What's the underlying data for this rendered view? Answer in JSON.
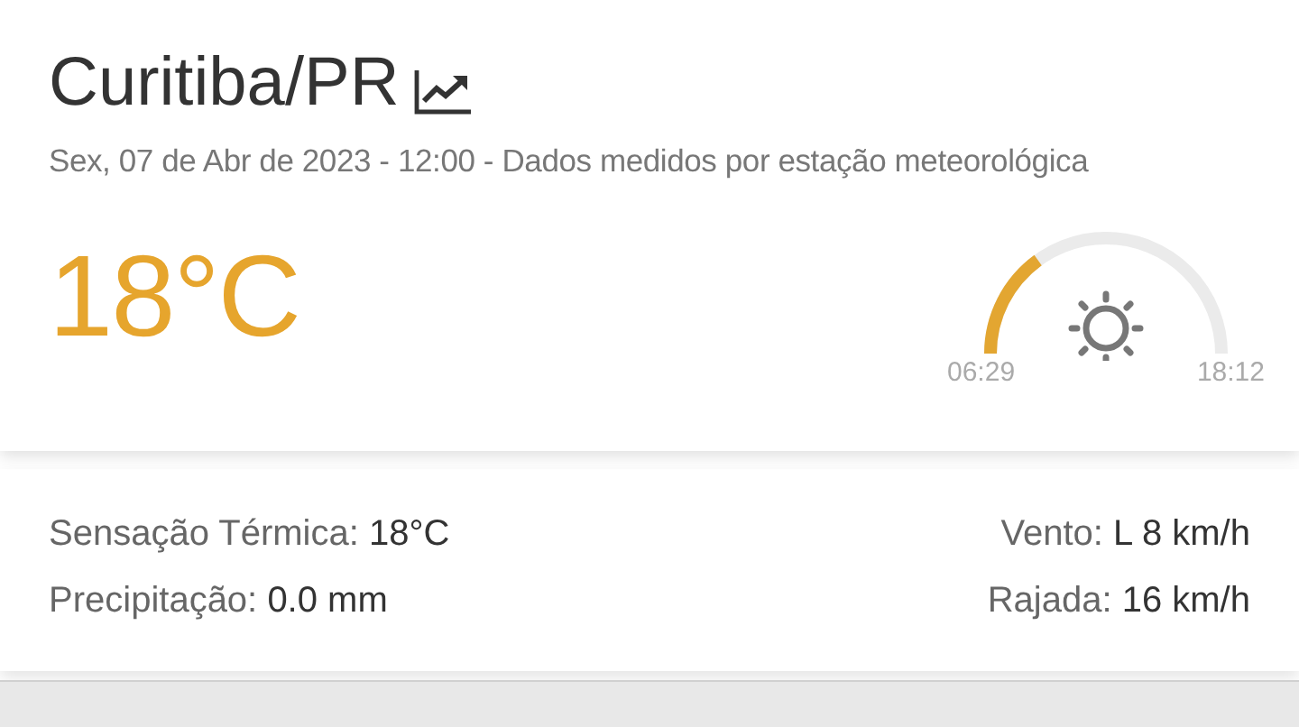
{
  "location": {
    "title": "Curitiba/PR"
  },
  "subtitle": "Sex, 07 de Abr de 2023 - 12:00 - Dados medidos por estação meteorológica",
  "temperature": "18°C",
  "sun": {
    "sunrise": "06:29",
    "sunset": "18:12"
  },
  "details": [
    {
      "label": "Sensação Térmica:",
      "value": "18°C"
    },
    {
      "label": "Vento:",
      "value": "L 8 km/h"
    },
    {
      "label": "Precipitação:",
      "value": "0.0 mm"
    },
    {
      "label": "Rajada:",
      "value": "16 km/h"
    }
  ]
}
